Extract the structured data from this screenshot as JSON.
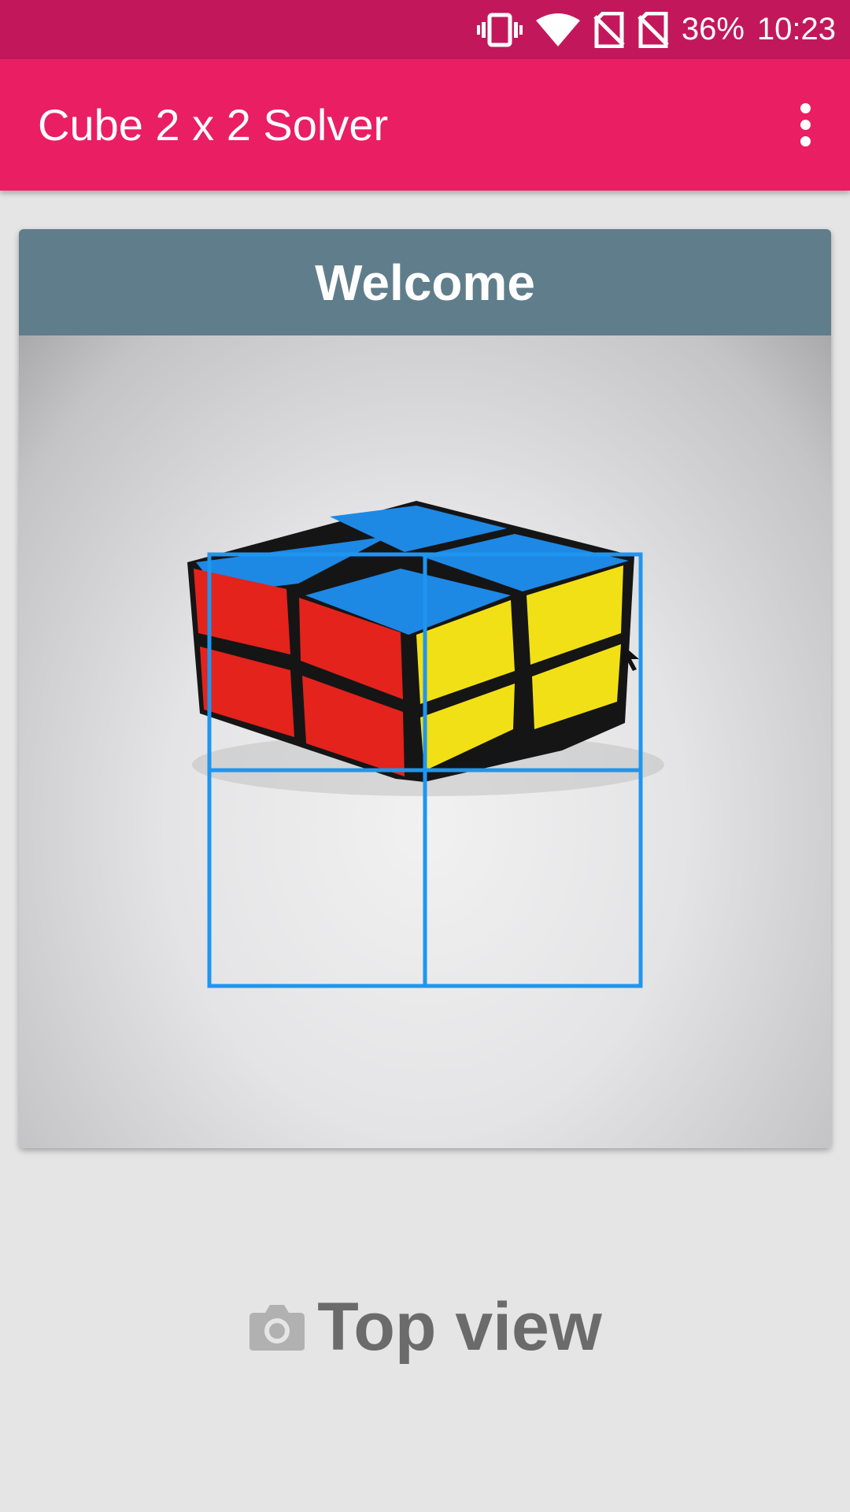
{
  "status_bar": {
    "battery": "36%",
    "time": "10:23",
    "icons": [
      "vibrate-icon",
      "wifi-icon",
      "no-sim-icon",
      "no-sim-icon"
    ]
  },
  "app_bar": {
    "title": "Cube 2 x 2 Solver",
    "overflow_icon": "more-vertical-icon"
  },
  "card": {
    "title": "Welcome",
    "camera_overlay": "2x2 grid guide"
  },
  "capture": {
    "icon": "camera-icon",
    "label": "Top view"
  },
  "colors": {
    "status_bar": "#c2185b",
    "app_bar": "#e91e63",
    "card_header": "#607d8b",
    "grid_overlay": "#1e96f0",
    "background": "#e5e5e5"
  }
}
